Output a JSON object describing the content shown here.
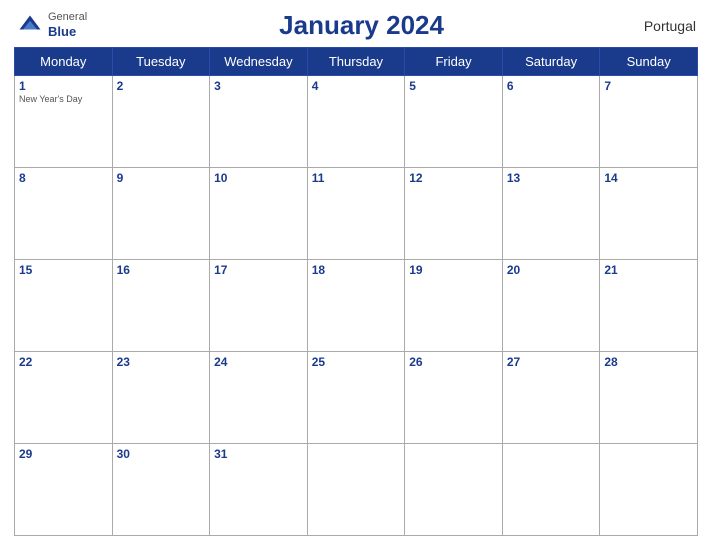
{
  "header": {
    "title": "January 2024",
    "country": "Portugal",
    "logo_general": "General",
    "logo_blue": "Blue"
  },
  "days_of_week": [
    "Monday",
    "Tuesday",
    "Wednesday",
    "Thursday",
    "Friday",
    "Saturday",
    "Sunday"
  ],
  "weeks": [
    [
      {
        "day": "1",
        "holiday": "New Year's Day"
      },
      {
        "day": "2",
        "holiday": ""
      },
      {
        "day": "3",
        "holiday": ""
      },
      {
        "day": "4",
        "holiday": ""
      },
      {
        "day": "5",
        "holiday": ""
      },
      {
        "day": "6",
        "holiday": ""
      },
      {
        "day": "7",
        "holiday": ""
      }
    ],
    [
      {
        "day": "8",
        "holiday": ""
      },
      {
        "day": "9",
        "holiday": ""
      },
      {
        "day": "10",
        "holiday": ""
      },
      {
        "day": "11",
        "holiday": ""
      },
      {
        "day": "12",
        "holiday": ""
      },
      {
        "day": "13",
        "holiday": ""
      },
      {
        "day": "14",
        "holiday": ""
      }
    ],
    [
      {
        "day": "15",
        "holiday": ""
      },
      {
        "day": "16",
        "holiday": ""
      },
      {
        "day": "17",
        "holiday": ""
      },
      {
        "day": "18",
        "holiday": ""
      },
      {
        "day": "19",
        "holiday": ""
      },
      {
        "day": "20",
        "holiday": ""
      },
      {
        "day": "21",
        "holiday": ""
      }
    ],
    [
      {
        "day": "22",
        "holiday": ""
      },
      {
        "day": "23",
        "holiday": ""
      },
      {
        "day": "24",
        "holiday": ""
      },
      {
        "day": "25",
        "holiday": ""
      },
      {
        "day": "26",
        "holiday": ""
      },
      {
        "day": "27",
        "holiday": ""
      },
      {
        "day": "28",
        "holiday": ""
      }
    ],
    [
      {
        "day": "29",
        "holiday": ""
      },
      {
        "day": "30",
        "holiday": ""
      },
      {
        "day": "31",
        "holiday": ""
      },
      {
        "day": "",
        "holiday": ""
      },
      {
        "day": "",
        "holiday": ""
      },
      {
        "day": "",
        "holiday": ""
      },
      {
        "day": "",
        "holiday": ""
      }
    ]
  ],
  "colors": {
    "header_bg": "#1a3a8c",
    "accent": "#1a3a8c"
  }
}
